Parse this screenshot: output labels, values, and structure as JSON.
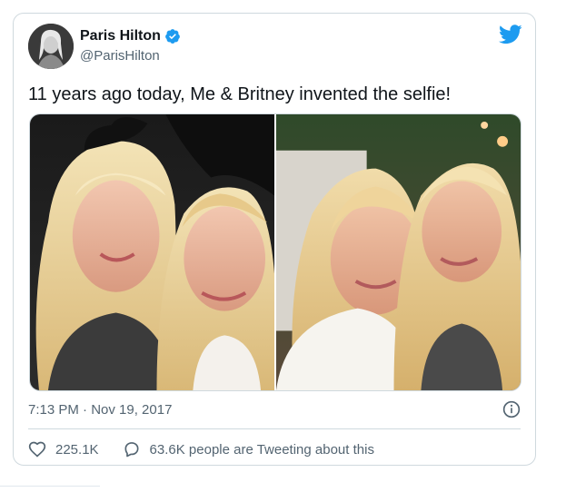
{
  "user": {
    "display_name": "Paris Hilton",
    "handle": "@ParisHilton",
    "verified": true,
    "avatar_icon": "profile-photo"
  },
  "brand_icon": "twitter-bird-icon",
  "colors": {
    "twitter_blue": "#1d9bf0",
    "text_primary": "#0f1419",
    "text_secondary": "#536471",
    "border": "#cfd9de"
  },
  "tweet": {
    "text": "11 years ago today, Me & Britney invented the selfie!",
    "timestamp": "7:13 PM · Nov 19, 2017",
    "likes": "225.1K",
    "replies_text": "63.6K people are Tweeting about this"
  },
  "media": [
    {
      "description_icon": "selfie-photo-left"
    },
    {
      "description_icon": "selfie-photo-right"
    }
  ]
}
